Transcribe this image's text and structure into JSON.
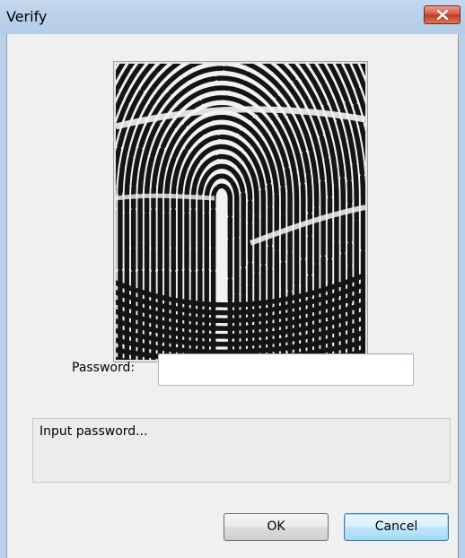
{
  "window": {
    "title": "Verify"
  },
  "icons": {
    "close": "close-icon",
    "fingerprint": "fingerprint-image"
  },
  "form": {
    "password_label": "Password:",
    "password_value": ""
  },
  "status": {
    "message": "Input password..."
  },
  "buttons": {
    "ok_label": "OK",
    "cancel_label": "Cancel"
  },
  "colors": {
    "close_button": "#c13a23",
    "focus_border": "#3c7fb1"
  }
}
